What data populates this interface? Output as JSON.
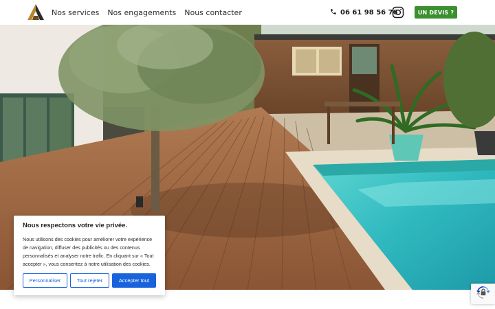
{
  "nav": {
    "items": [
      {
        "label": "Nos services"
      },
      {
        "label": "Nos engagements"
      },
      {
        "label": "Nous contacter"
      }
    ]
  },
  "contact": {
    "phone": "06 61 98 56 76"
  },
  "header": {
    "cta_label": "UN DEVIS ?"
  },
  "colors": {
    "cta_green": "#3a8f2e",
    "cookie_blue": "#1863dc",
    "logo_gold": "#b8862f",
    "logo_dark": "#2b2b2b"
  },
  "icons": {
    "phone": "phone-icon",
    "social": "instagram-icon",
    "captcha": "recaptcha-icon"
  },
  "cookie": {
    "title": "Nous respectons votre vie privée.",
    "text": "Nous utilisons des cookies pour améliorer votre expérience de navigation, diffuser des publicités ou des contenus personnalisés et analyser notre trafic. En cliquant sur « Tout accepter », vous consentez à notre utilisation des cookies.",
    "buttons": {
      "customize": "Personnaliser",
      "reject": "Tout rejeter",
      "accept": "Accepter tout"
    }
  }
}
